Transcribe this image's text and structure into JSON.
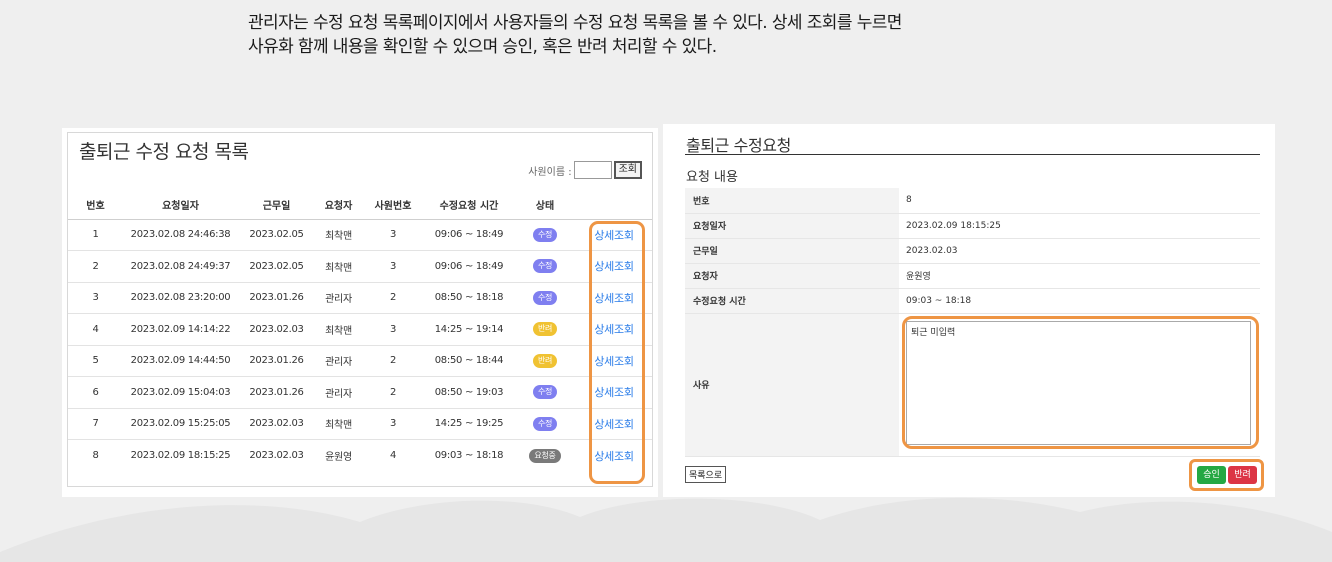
{
  "caption": {
    "line1": "관리자는 수정 요청 목록페이지에서 사용자들의 수정 요청 목록을 볼 수 있다. 상세 조회를 누르면",
    "line2": "사유화 함께 내용을 확인할 수 있으며 승인, 혹은 반려 처리할 수 있다."
  },
  "list": {
    "title": "출퇴근 수정 요청 목록",
    "search_label": "사원이름 :",
    "search_button": "조회",
    "headers": [
      "번호",
      "요청일자",
      "근무일",
      "요청자",
      "사원번호",
      "수정요청 시간",
      "상태",
      ""
    ],
    "rows": [
      {
        "no": "1",
        "req_date": "2023.02.08 24:46:38",
        "work_date": "2023.02.05",
        "requester": "최착맨",
        "emp_no": "3",
        "time": "09:06 ~ 18:49",
        "status": "수정",
        "link": "상세조회"
      },
      {
        "no": "2",
        "req_date": "2023.02.08 24:49:37",
        "work_date": "2023.02.05",
        "requester": "최착맨",
        "emp_no": "3",
        "time": "09:06 ~ 18:49",
        "status": "수정",
        "link": "상세조회"
      },
      {
        "no": "3",
        "req_date": "2023.02.08 23:20:00",
        "work_date": "2023.01.26",
        "requester": "관리자",
        "emp_no": "2",
        "time": "08:50 ~ 18:18",
        "status": "수정",
        "link": "상세조회"
      },
      {
        "no": "4",
        "req_date": "2023.02.09 14:14:22",
        "work_date": "2023.02.03",
        "requester": "최착맨",
        "emp_no": "3",
        "time": "14:25 ~ 19:14",
        "status": "반려",
        "link": "상세조회"
      },
      {
        "no": "5",
        "req_date": "2023.02.09 14:44:50",
        "work_date": "2023.01.26",
        "requester": "관리자",
        "emp_no": "2",
        "time": "08:50 ~ 18:44",
        "status": "반려",
        "link": "상세조회"
      },
      {
        "no": "6",
        "req_date": "2023.02.09 15:04:03",
        "work_date": "2023.01.26",
        "requester": "관리자",
        "emp_no": "2",
        "time": "08:50 ~ 19:03",
        "status": "수정",
        "link": "상세조회"
      },
      {
        "no": "7",
        "req_date": "2023.02.09 15:25:05",
        "work_date": "2023.02.03",
        "requester": "최착맨",
        "emp_no": "3",
        "time": "14:25 ~ 19:25",
        "status": "수정",
        "link": "상세조회"
      },
      {
        "no": "8",
        "req_date": "2023.02.09 18:15:25",
        "work_date": "2023.02.03",
        "requester": "윤원영",
        "emp_no": "4",
        "time": "09:03 ~ 18:18",
        "status": "요청중",
        "link": "상세조회"
      }
    ]
  },
  "status_colors": {
    "수정": "#7f7ff0",
    "반려": "#f0c232",
    "요청중": "#7a7a7a"
  },
  "detail": {
    "title": "출퇴근 수정요청",
    "subtitle": "요청 내용",
    "fields": [
      {
        "label": "번호",
        "value": "8"
      },
      {
        "label": "요청일자",
        "value": "2023.02.09 18:15:25"
      },
      {
        "label": "근무일",
        "value": "2023.02.03"
      },
      {
        "label": "요청자",
        "value": "윤원영"
      },
      {
        "label": "수정요청 시간",
        "value": "09:03 ~ 18:18"
      }
    ],
    "reason_label": "사유",
    "reason_text": "퇴근 미입력",
    "back_button": "목록으로",
    "approve_button": "승인",
    "reject_button": "반려"
  },
  "highlight_color": "#ee9544"
}
